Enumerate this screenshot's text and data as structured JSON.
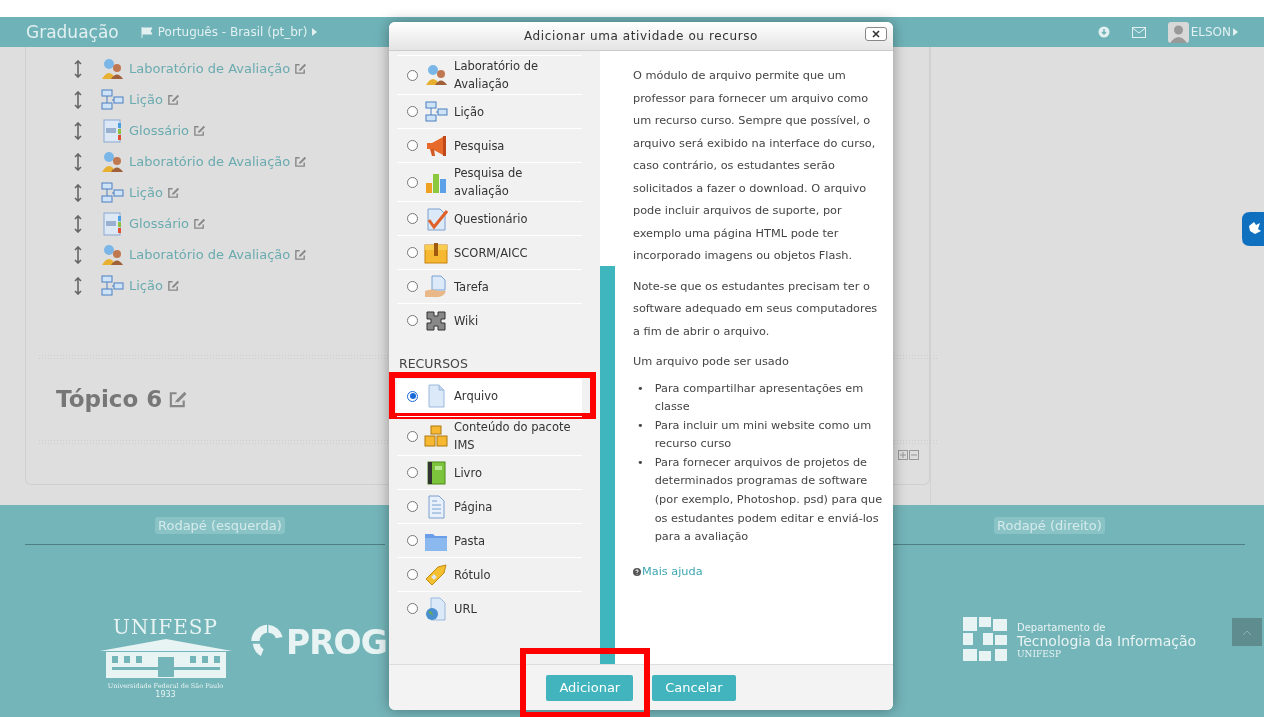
{
  "navbar": {
    "site_title": "Graduação",
    "language": "Português - Brasil (pt_br)",
    "user_name": "ELSON"
  },
  "course_activities": [
    {
      "kind": "workshop",
      "label": "Laboratório de Avaliação"
    },
    {
      "kind": "lesson",
      "label": "Lição"
    },
    {
      "kind": "glossary",
      "label": "Glossário"
    },
    {
      "kind": "workshop",
      "label": "Laboratório de Avaliação"
    },
    {
      "kind": "lesson",
      "label": "Lição"
    },
    {
      "kind": "glossary",
      "label": "Glossário"
    },
    {
      "kind": "workshop",
      "label": "Laboratório de Avaliação"
    },
    {
      "kind": "lesson",
      "label": "Lição"
    }
  ],
  "section_title": "Tópico 6",
  "footer": {
    "left_heading": "Rodapé (esquerda)",
    "right_heading": "Rodapé (direito)",
    "unifesp_logo": {
      "name": "UNIFESP",
      "subtitle": "Universidade Federal de São Paulo",
      "year": "1933"
    },
    "prog_logo": "PROG",
    "dti_logo": {
      "line_1": "Departamento de",
      "line_2": "Tecnologia da Informação",
      "line_3": "UNIFESP"
    }
  },
  "dialog": {
    "title": "Adicionar uma atividade ou recurso",
    "groups": [
      {
        "items": [
          {
            "kind": "workshop",
            "label": "Laboratório de Avaliação",
            "selected": false,
            "highlighted": false
          },
          {
            "kind": "lesson",
            "label": "Lição",
            "selected": false,
            "highlighted": false
          },
          {
            "kind": "survey",
            "label": "Pesquisa",
            "selected": false,
            "highlighted": false
          },
          {
            "kind": "feedback",
            "label": "Pesquisa de avaliação",
            "selected": false,
            "highlighted": false
          },
          {
            "kind": "quiz",
            "label": "Questionário",
            "selected": false,
            "highlighted": false
          },
          {
            "kind": "scorm",
            "label": "SCORM/AICC",
            "selected": false,
            "highlighted": false
          },
          {
            "kind": "assign",
            "label": "Tarefa",
            "selected": false,
            "highlighted": false
          },
          {
            "kind": "wiki",
            "label": "Wiki",
            "selected": false,
            "highlighted": false
          }
        ]
      },
      {
        "heading": "RECURSOS",
        "items": [
          {
            "kind": "file",
            "label": "Arquivo",
            "selected": true,
            "highlighted": true
          },
          {
            "kind": "imscp",
            "label": "Conteúdo do pacote IMS",
            "selected": false,
            "highlighted": false
          },
          {
            "kind": "book",
            "label": "Livro",
            "selected": false,
            "highlighted": false
          },
          {
            "kind": "page",
            "label": "Página",
            "selected": false,
            "highlighted": false
          },
          {
            "kind": "folder",
            "label": "Pasta",
            "selected": false,
            "highlighted": false
          },
          {
            "kind": "label",
            "label": "Rótulo",
            "selected": false,
            "highlighted": false
          },
          {
            "kind": "url",
            "label": "URL",
            "selected": false,
            "highlighted": false
          }
        ]
      }
    ],
    "help": {
      "paragraphs": [
        "O módulo de arquivo permite que um professor para fornecer um arquivo como um recurso curso. Sempre que possível, o arquivo será exibido na interface do curso, caso contrário, os estudantes serão solicitados a fazer o download. O arquivo pode incluir arquivos de suporte, por exemplo uma página HTML pode ter incorporado imagens ou objetos Flash.",
        "Note-se que os estudantes precisam ter o software adequado em seus computadores a fim de abrir o arquivo.",
        "Um arquivo pode ser usado"
      ],
      "bullets": [
        {
          "marker": "•",
          "text": "Para compartilhar apresentações em classe"
        },
        {
          "marker": "•",
          "text": "Para incluir um mini website como um recurso curso"
        },
        {
          "marker": "•",
          "text": "Para fornecer arquivos de projetos de determinados programas de software (por exemplo, Photoshop. psd) para que os estudantes podem editar e enviá-los para a avaliação"
        }
      ],
      "more_help": "Mais ajuda"
    },
    "buttons": [
      {
        "label": "Adicionar",
        "highlighted": true
      },
      {
        "label": "Cancelar",
        "highlighted": false
      }
    ]
  }
}
